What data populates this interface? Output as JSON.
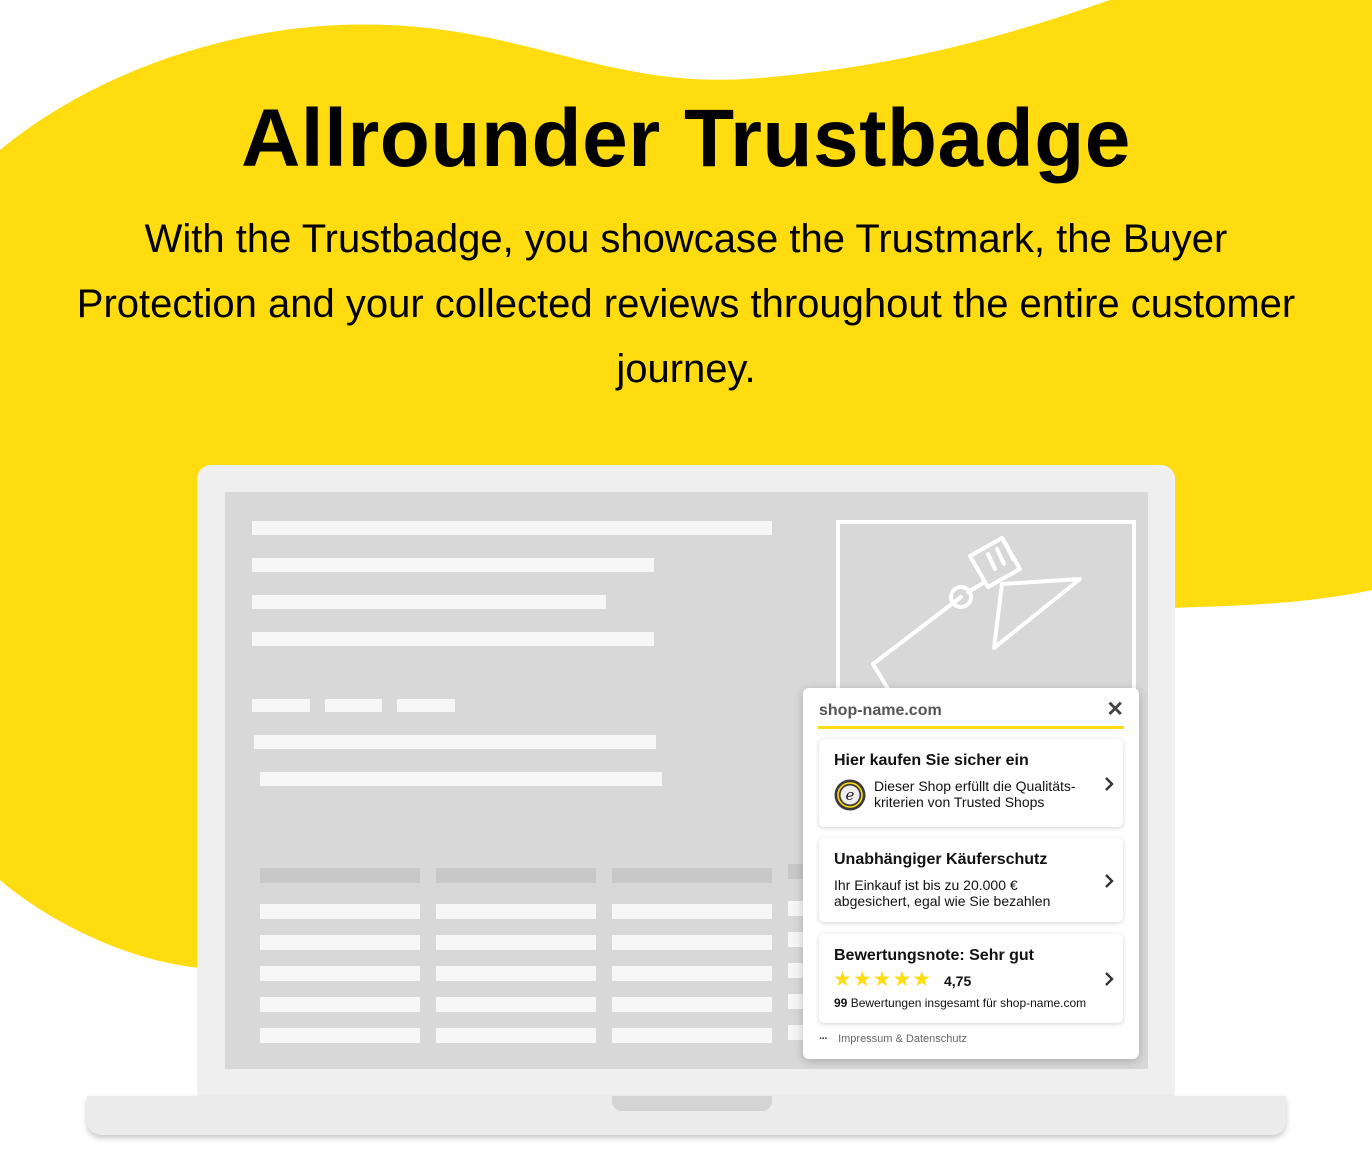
{
  "hero": {
    "title": "Allrounder Trustbadge",
    "subtitle": "With the Trustbadge, you showcase the Trustmark, the Buyer Protection and your collected reviews throughout the entire customer journey."
  },
  "colors": {
    "brand_yellow": "#ffdc0f",
    "screen_gray": "#d8d8d8",
    "laptop_gray": "#efefef"
  },
  "trustbadge": {
    "shop_name": "shop-name.com",
    "close_label": "✕",
    "cards": [
      {
        "title": "Hier kaufen Sie sicher ein",
        "text": "Dieser Shop erfüllt die Qualitäts-kriterien von Trusted Shops",
        "icon": "trusted-shops-seal-icon"
      },
      {
        "title": "Unabhängiger Käuferschutz",
        "text": "Ihr Einkauf ist bis zu 20.000 € abgesichert, egal wie Sie bezahlen"
      },
      {
        "title": "Bewertungsnote: Sehr gut",
        "stars": "★★★★★",
        "rating": "4,75",
        "review_count": "99",
        "review_text": "Bewertungen insgesamt für shop-name.com"
      }
    ],
    "footer_dots": "···",
    "footer_link": "Impressum & Datenschutz"
  }
}
